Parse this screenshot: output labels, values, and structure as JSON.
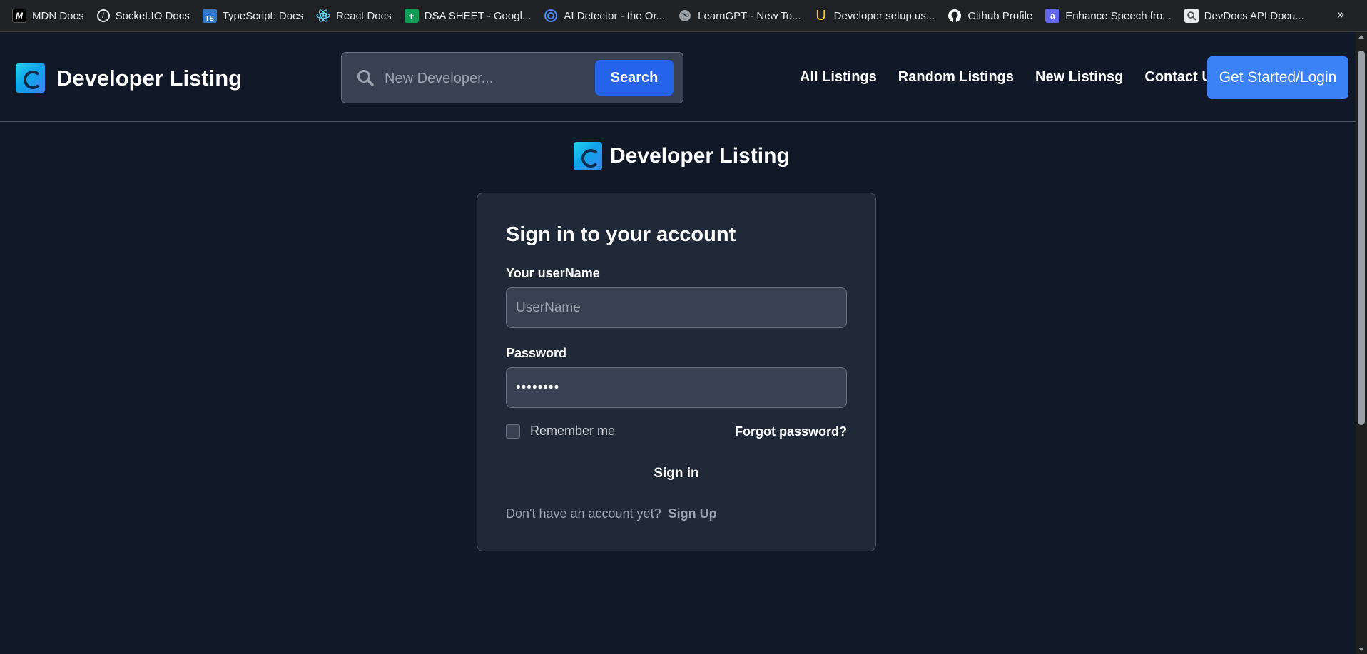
{
  "bookmarks": [
    {
      "label": "MDN Docs",
      "icon": "mdn-icon",
      "color": "#000000"
    },
    {
      "label": "Socket.IO Docs",
      "icon": "socketio-icon",
      "color": "#1a1a1a"
    },
    {
      "label": "TypeScript: Docs",
      "icon": "typescript-icon",
      "color": "#3178c6",
      "glyph": "TS"
    },
    {
      "label": "React Docs",
      "icon": "react-icon",
      "color": "#61dafb"
    },
    {
      "label": "DSA SHEET - Googl...",
      "icon": "sheets-icon",
      "color": "#0f9d58"
    },
    {
      "label": "AI Detector - the Or...",
      "icon": "ai-detector-icon",
      "color": "#4a8af4"
    },
    {
      "label": "LearnGPT - New To...",
      "icon": "globe-icon",
      "color": "#9aa0a6"
    },
    {
      "label": "Developer setup us...",
      "icon": "u-logo-icon",
      "color": "#facc15"
    },
    {
      "label": "Github Profile",
      "icon": "github-icon",
      "color": "#ffffff"
    },
    {
      "label": "Enhance Speech fro...",
      "icon": "enhance-speech-icon",
      "color": "#6366f1"
    },
    {
      "label": "DevDocs API Docu...",
      "icon": "devdocs-icon",
      "color": "#e8eaed"
    }
  ],
  "header": {
    "brand": "Developer Listing",
    "search_placeholder": "New Developer...",
    "search_button": "Search",
    "nav": [
      "All Listings",
      "Random Listings",
      "New Listinsg",
      "Contact Us"
    ],
    "login_button": "Get Started/Login"
  },
  "page": {
    "brand": "Developer Listing"
  },
  "form": {
    "title": "Sign in to your account",
    "username_label": "Your userName",
    "username_placeholder": "UserName",
    "password_label": "Password",
    "password_value": "••••••••",
    "remember_label": "Remember me",
    "forgot_link": "Forgot password?",
    "signin_button": "Sign in",
    "signup_prompt": "Don't have an account yet?",
    "signup_link": "Sign Up"
  },
  "colors": {
    "background": "#111827",
    "card": "#1f2937",
    "accent": "#3b82f6",
    "search_button": "#2563eb"
  }
}
